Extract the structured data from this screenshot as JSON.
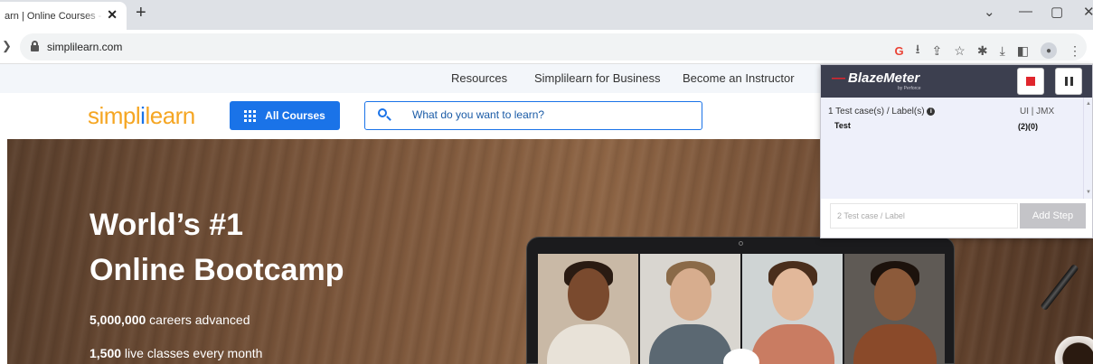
{
  "browser": {
    "tab_title": "arn | Online Courses - Bo",
    "tab_close": "✕",
    "new_tab": "+",
    "back_glyph": "❯",
    "url": "simplilearn.com",
    "extension_icons": [
      "G",
      "⭳",
      "⇪",
      "☆",
      "✱",
      "⤓",
      "◧",
      "●",
      "⋮"
    ],
    "window_controls": [
      "⌄",
      "—",
      "▢",
      "✕"
    ]
  },
  "site": {
    "topnav": [
      "Resources",
      "Simplilearn for Business",
      "Become an Instructor"
    ],
    "logo_part1": "simpl",
    "logo_part2": "i",
    "logo_part3": "learn",
    "all_courses_label": "All Courses",
    "search_placeholder": "What do you want to learn?",
    "hero_title_line1": "World’s #1",
    "hero_title_line2": "Online Bootcamp",
    "stats": [
      {
        "value": "5,000,000",
        "label": " careers advanced"
      },
      {
        "value": "1,500",
        "label": " live classes every month"
      }
    ]
  },
  "blazemeter": {
    "logo": "BlazeMeter",
    "logo_sub": "by Perforce",
    "list_header": "1 Test case(s) / Label(s)",
    "info_glyph": "i",
    "format_label": "UI | JMX",
    "test_name": "Test",
    "test_counts": "(2)(0)",
    "new_label_placeholder": "2 Test case / Label",
    "add_step_label": "Add Step"
  },
  "colors": {
    "brand_blue": "#1a73e8",
    "brand_orange": "#f5a623",
    "bm_header": "#3c3f4f",
    "bm_red": "#e0262d"
  }
}
